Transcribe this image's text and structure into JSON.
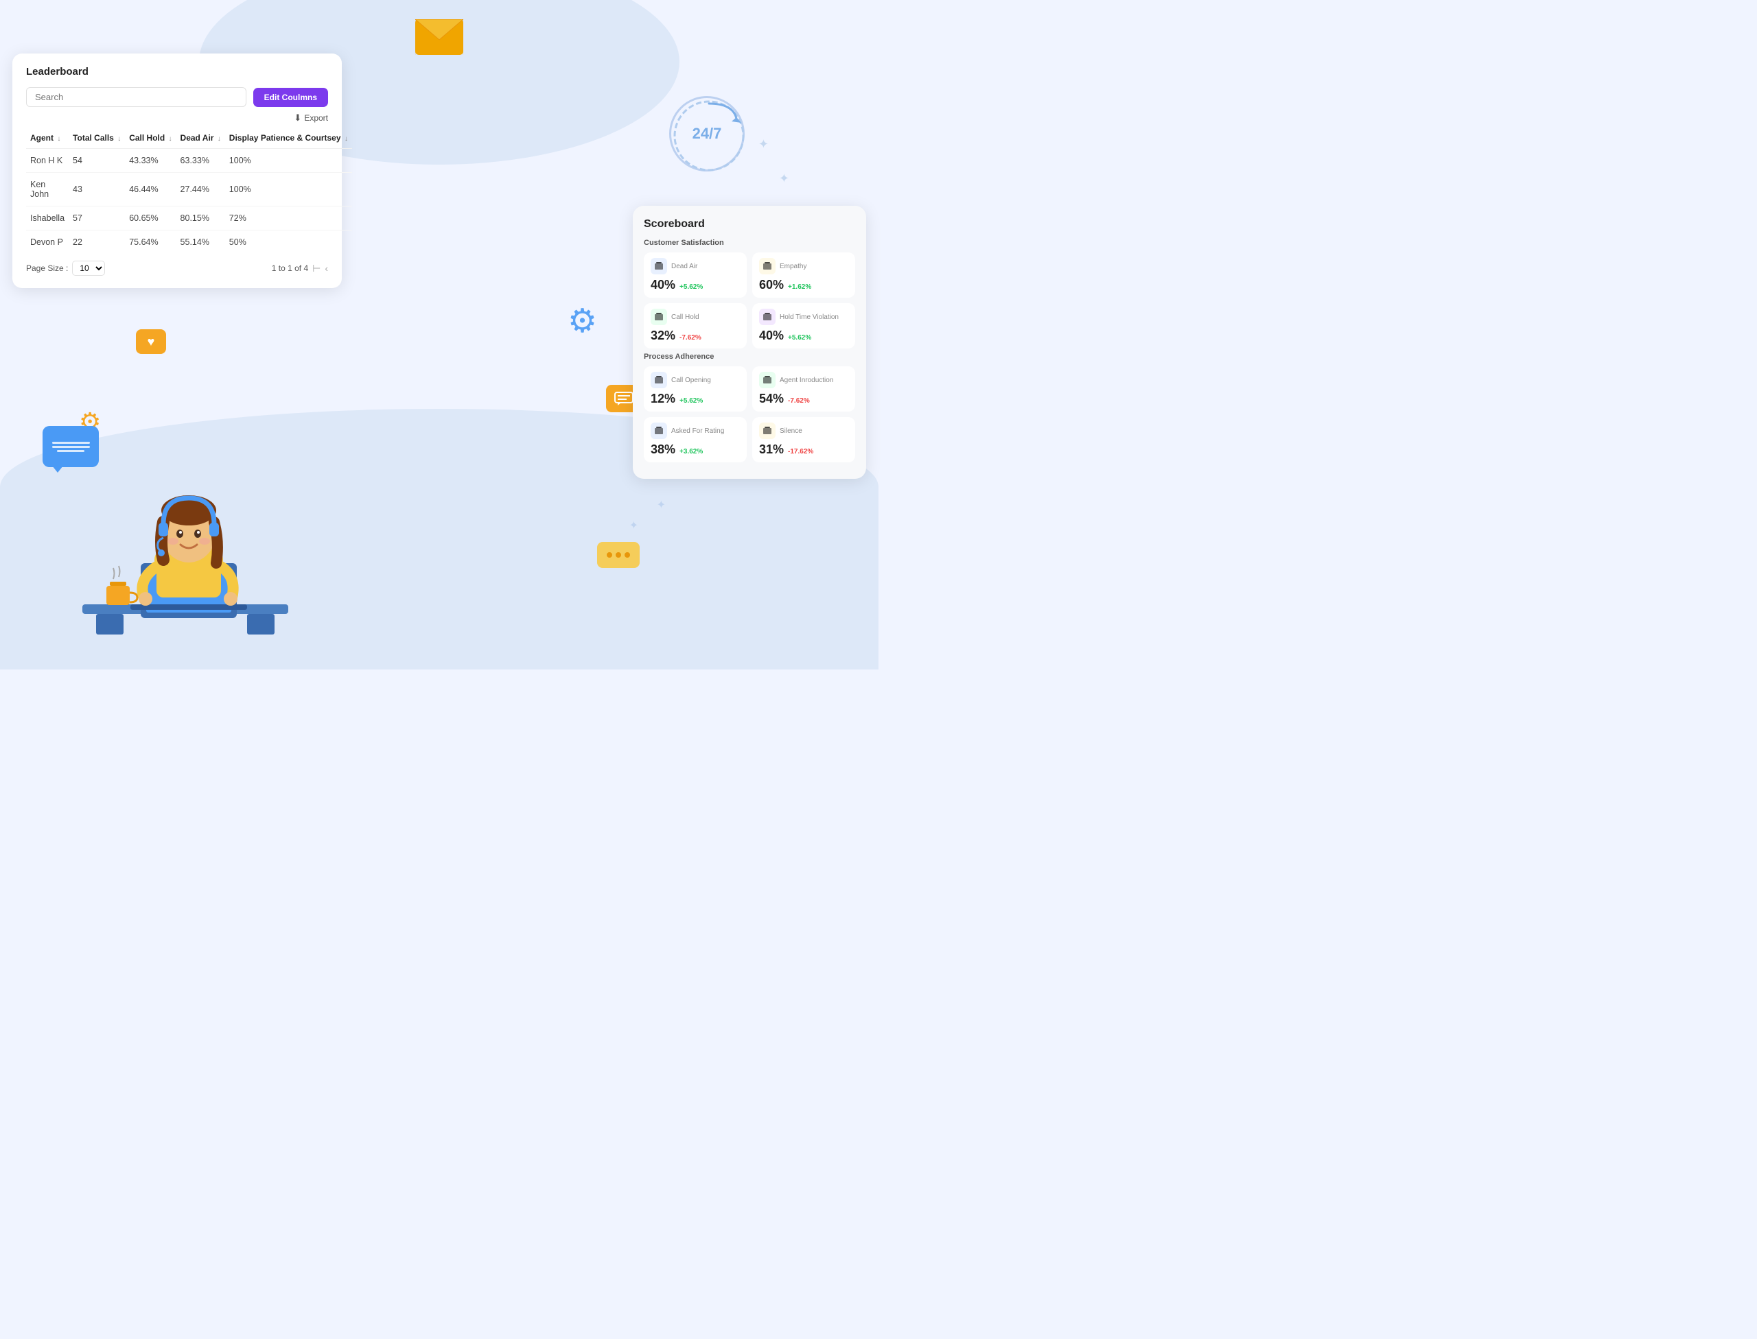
{
  "background": {
    "color": "#f0f4ff"
  },
  "leaderboard": {
    "title": "Leaderboard",
    "search_placeholder": "Search",
    "edit_columns_label": "Edit Coulmns",
    "export_label": "Export",
    "columns": [
      {
        "key": "agent",
        "label": "Agent",
        "sortable": true
      },
      {
        "key": "total_calls",
        "label": "Total Calls",
        "sortable": true
      },
      {
        "key": "call_hold",
        "label": "Call Hold",
        "sortable": true
      },
      {
        "key": "dead_air",
        "label": "Dead Air",
        "sortable": true
      },
      {
        "key": "patience",
        "label": "Display Patience & Courtsey",
        "sortable": true
      }
    ],
    "rows": [
      {
        "agent": "Ron H K",
        "total_calls": "54",
        "call_hold": "43.33%",
        "dead_air": "63.33%",
        "patience": "100%"
      },
      {
        "agent": "Ken John",
        "total_calls": "43",
        "call_hold": "46.44%",
        "dead_air": "27.44%",
        "patience": "100%"
      },
      {
        "agent": "Ishabella",
        "total_calls": "57",
        "call_hold": "60.65%",
        "dead_air": "80.15%",
        "patience": "72%"
      },
      {
        "agent": "Devon P",
        "total_calls": "22",
        "call_hold": "75.64%",
        "dead_air": "55.14%",
        "patience": "50%"
      }
    ],
    "page_size_label": "Page Size :",
    "page_size_value": "10",
    "pagination_info": "1 to 1 of 4"
  },
  "circle_247": {
    "label": "24/7"
  },
  "scoreboard": {
    "title": "Scoreboard",
    "sections": [
      {
        "label": "Customer Satisfaction",
        "cards": [
          {
            "name": "Dead Air",
            "value": "40%",
            "change": "+5.62%",
            "change_type": "positive",
            "icon_color": "blue"
          },
          {
            "name": "Empathy",
            "value": "60%",
            "change": "+1.62%",
            "change_type": "positive",
            "icon_color": "yellow"
          },
          {
            "name": "Call Hold",
            "value": "32%",
            "change": "-7.62%",
            "change_type": "negative",
            "icon_color": "green"
          },
          {
            "name": "Hold Time Violation",
            "value": "40%",
            "change": "+5.62%",
            "change_type": "positive",
            "icon_color": "purple"
          }
        ]
      },
      {
        "label": "Process Adherence",
        "cards": [
          {
            "name": "Call Opening",
            "value": "12%",
            "change": "+5.62%",
            "change_type": "positive",
            "icon_color": "blue"
          },
          {
            "name": "Agent Inroduction",
            "value": "54%",
            "change": "-7.62%",
            "change_type": "negative",
            "icon_color": "green"
          },
          {
            "name": "Asked For Rating",
            "value": "38%",
            "change": "+3.62%",
            "change_type": "positive",
            "icon_color": "blue"
          },
          {
            "name": "Silence",
            "value": "31%",
            "change": "-17.62%",
            "change_type": "negative",
            "icon_color": "yellow"
          }
        ]
      }
    ]
  }
}
